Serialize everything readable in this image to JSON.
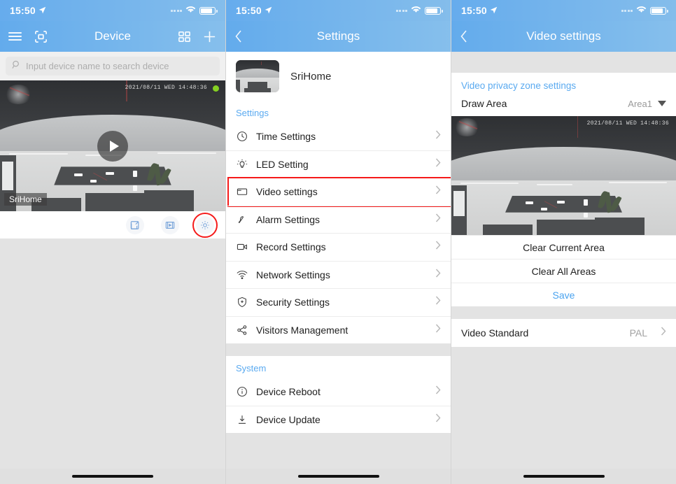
{
  "status_bar": {
    "time": "15:50",
    "location_icon": "location-arrow-icon",
    "wifi_icon": "wifi-icon",
    "battery_icon": "battery-icon"
  },
  "colors": {
    "header_blue_left": "#63abec",
    "header_blue_right": "#86bfec",
    "accent_blue": "#4aa3ef",
    "link_blue": "#5aaaf0",
    "highlight_red": "#f51a1a",
    "online_green": "#85d022"
  },
  "screen1": {
    "nav": {
      "title": "Device",
      "menu_icon": "hamburger-menu-icon",
      "scan_icon": "qr-scan-icon",
      "grid_icon": "grid-view-icon",
      "add_icon": "plus-icon"
    },
    "search": {
      "placeholder": "Input device name to search device",
      "value": "",
      "icon": "search-icon"
    },
    "device_card": {
      "name": "SriHome",
      "timestamp": "2021/08/11  WED 14:48:36",
      "status": "online",
      "play_icon": "play-icon",
      "actions": [
        {
          "name": "edit-icon",
          "label": "Edit",
          "highlighted": false
        },
        {
          "name": "playback-icon",
          "label": "Playback",
          "highlighted": false
        },
        {
          "name": "gear-icon",
          "label": "Settings",
          "highlighted": true
        }
      ]
    }
  },
  "screen2": {
    "nav": {
      "title": "Settings",
      "back_icon": "chevron-left-icon"
    },
    "device": {
      "name": "SriHome"
    },
    "sections": [
      {
        "title": "Settings",
        "items": [
          {
            "label": "Time Settings",
            "icon": "clock-icon",
            "highlighted": false
          },
          {
            "label": "LED Setting",
            "icon": "led-bulb-icon",
            "highlighted": false
          },
          {
            "label": "Video settings",
            "icon": "video-frame-icon",
            "highlighted": true
          },
          {
            "label": "Alarm Settings",
            "icon": "bell-icon",
            "highlighted": false
          },
          {
            "label": "Record Settings",
            "icon": "camcorder-icon",
            "highlighted": false
          },
          {
            "label": "Network Settings",
            "icon": "wifi-icon",
            "highlighted": false
          },
          {
            "label": "Security Settings",
            "icon": "shield-icon",
            "highlighted": false
          },
          {
            "label": "Visitors Management",
            "icon": "share-nodes-icon",
            "highlighted": false
          }
        ]
      },
      {
        "title": "System",
        "items": [
          {
            "label": "Device Reboot",
            "icon": "info-circle-icon",
            "highlighted": false
          },
          {
            "label": "Device Update",
            "icon": "download-icon",
            "highlighted": false
          }
        ]
      }
    ]
  },
  "screen3": {
    "nav": {
      "title": "Video settings",
      "back_icon": "chevron-left-icon"
    },
    "privacy_link": "Video privacy zone settings",
    "draw_area": {
      "label": "Draw Area",
      "value": "Area1",
      "caret_icon": "caret-down-icon"
    },
    "preview": {
      "timestamp": "2021/08/11  WED 14:48:36"
    },
    "actions": [
      {
        "label": "Clear Current Area",
        "style": "normal"
      },
      {
        "label": "Clear All Areas",
        "style": "normal"
      },
      {
        "label": "Save",
        "style": "blue"
      }
    ],
    "video_standard": {
      "label": "Video Standard",
      "value": "PAL",
      "chevron": "chevron-right-icon"
    }
  }
}
